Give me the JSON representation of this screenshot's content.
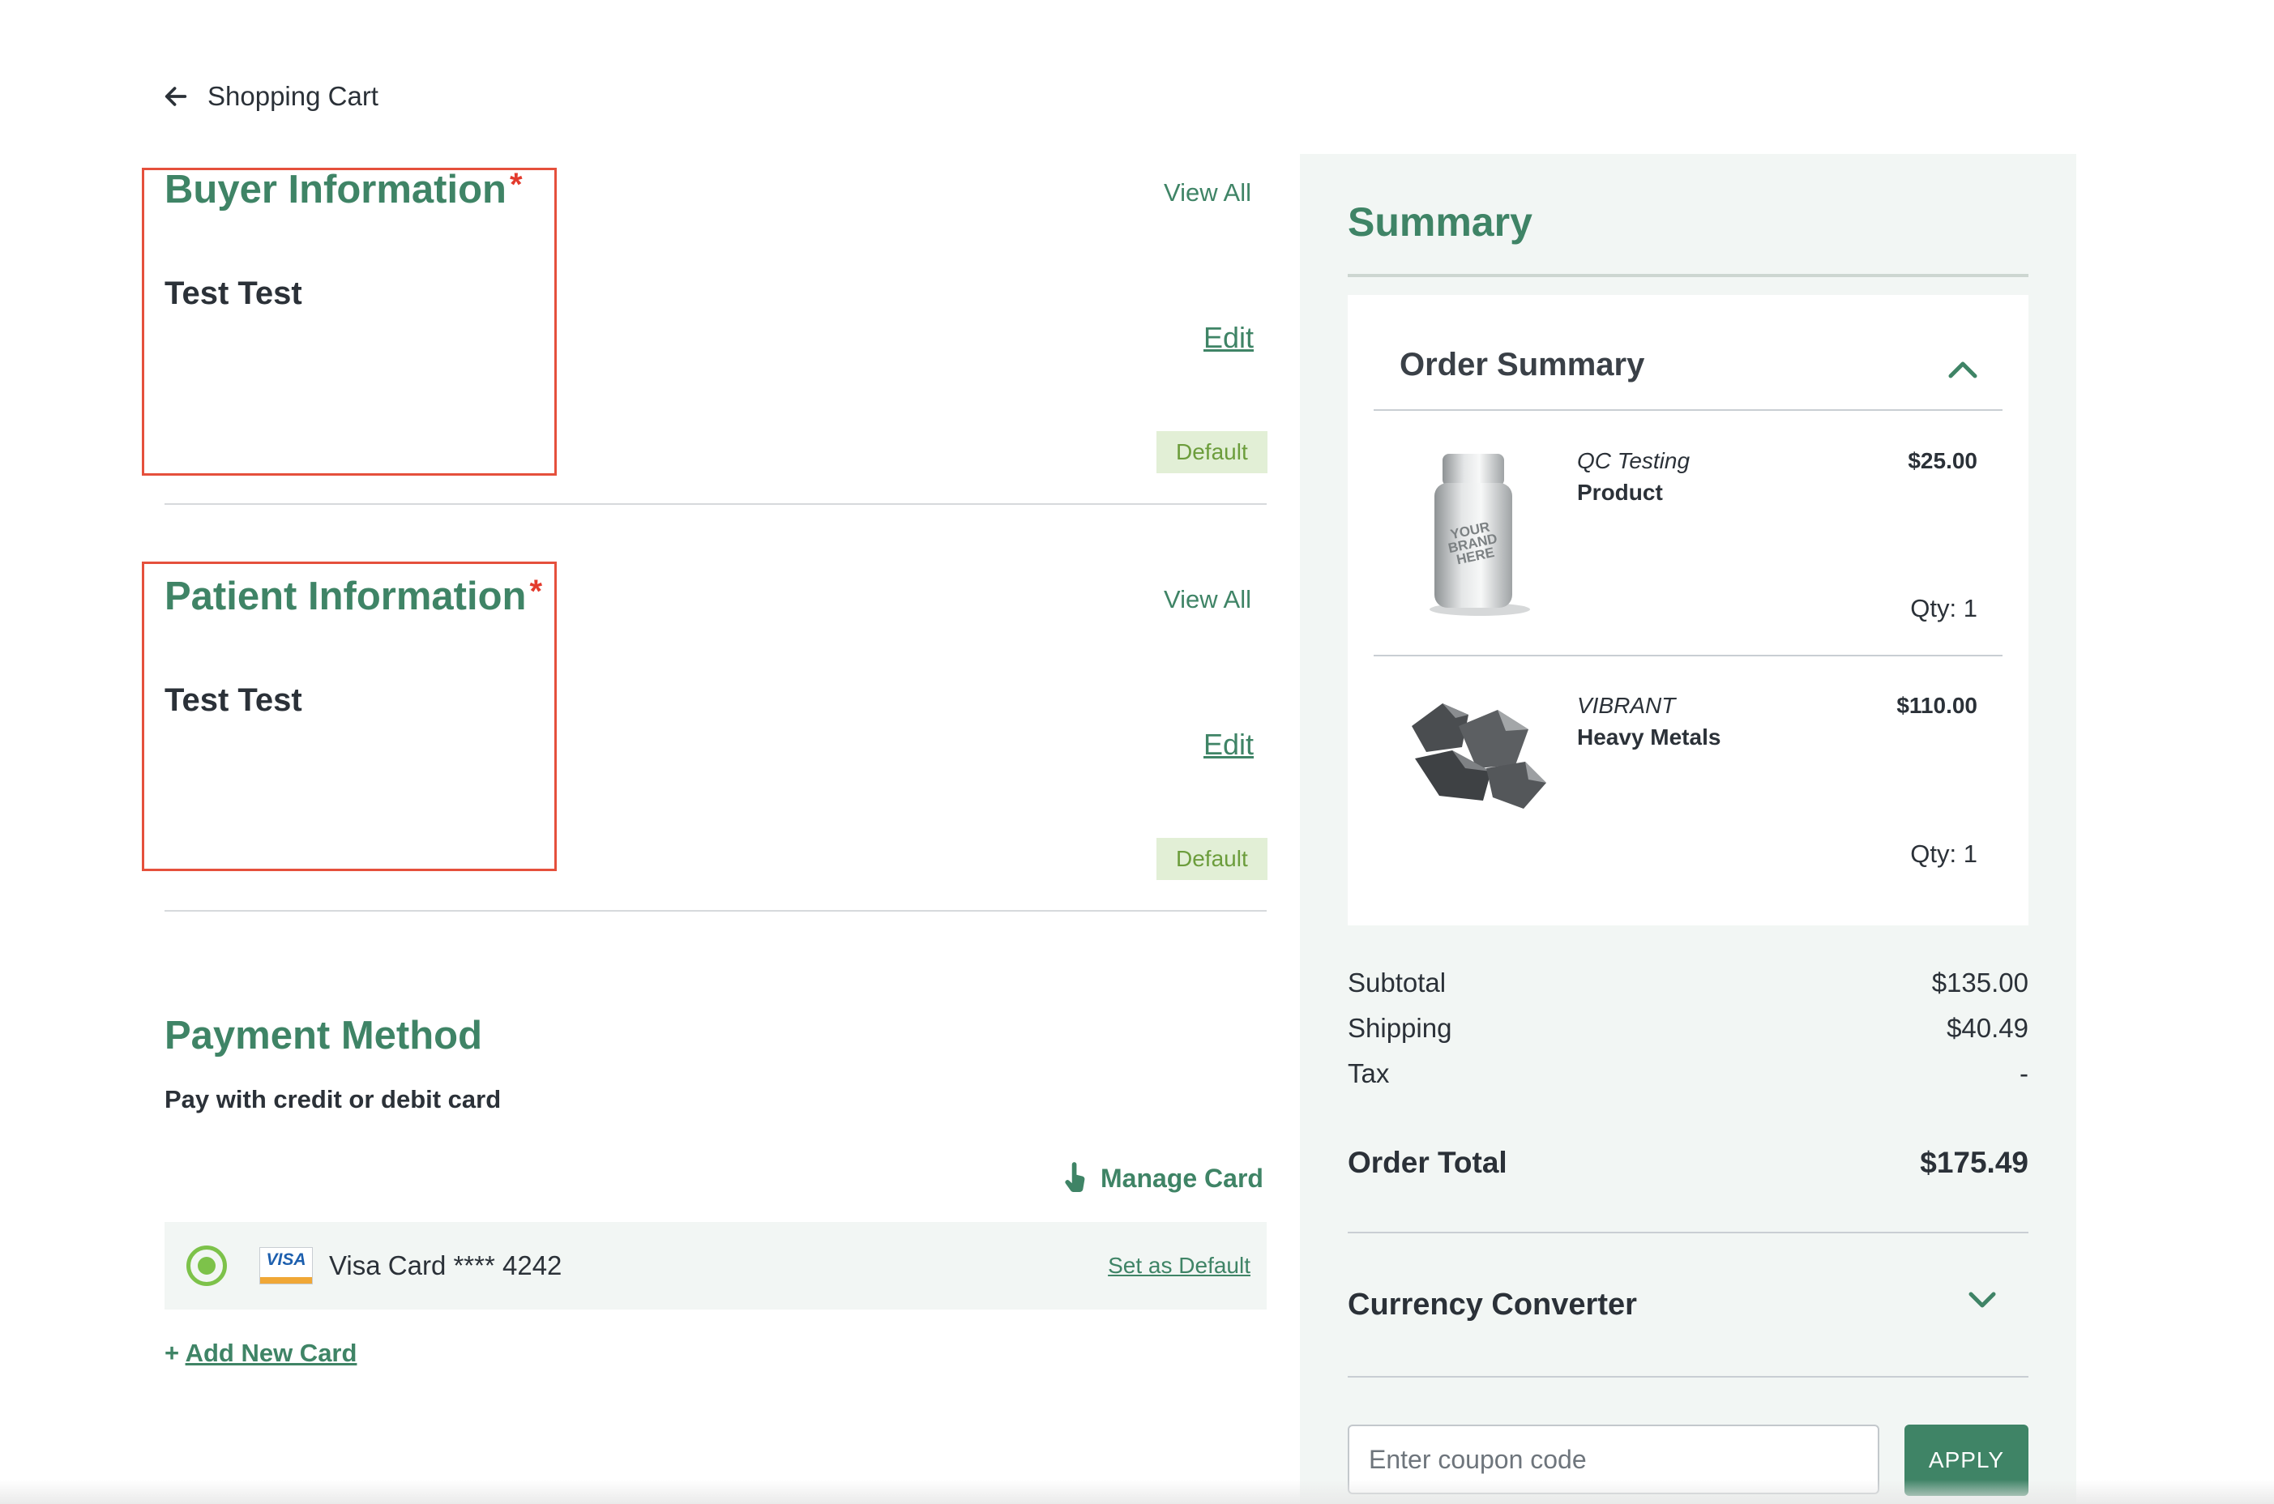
{
  "nav": {
    "back_label": "Shopping Cart"
  },
  "buyer": {
    "title": "Buyer Information",
    "required_mark": "*",
    "name": "Test Test",
    "view_all": "View All",
    "edit": "Edit",
    "badge": "Default"
  },
  "patient": {
    "title": "Patient Information",
    "required_mark": "*",
    "name": "Test Test",
    "view_all": "View All",
    "edit": "Edit",
    "badge": "Default"
  },
  "payment": {
    "title": "Payment Method",
    "subtitle": "Pay with credit or debit card",
    "manage_card": "Manage Card",
    "card": {
      "brand": "VISA",
      "label": "Visa Card **** 4242",
      "set_default": "Set as Default",
      "selected": true
    },
    "add_card_plus": "+",
    "add_card": "Add New Card"
  },
  "summary": {
    "title": "Summary",
    "order_summary": {
      "title": "Order Summary",
      "items": [
        {
          "category": "QC Testing",
          "name": "Product",
          "price": "$25.00",
          "qty": "Qty: 1",
          "image": "supplement-bottle",
          "image_text": "YOUR BRAND HERE"
        },
        {
          "category": "VIBRANT",
          "name": "Heavy Metals",
          "price": "$110.00",
          "qty": "Qty: 1",
          "image": "metal-rocks"
        }
      ]
    },
    "totals": {
      "subtotal_label": "Subtotal",
      "subtotal": "$135.00",
      "shipping_label": "Shipping",
      "shipping": "$40.49",
      "tax_label": "Tax",
      "tax": "-",
      "order_total_label": "Order Total",
      "order_total": "$175.49"
    },
    "currency_converter": "Currency Converter",
    "coupon": {
      "placeholder": "Enter coupon code",
      "apply": "APPLY"
    }
  },
  "colors": {
    "accent": "#3f8466",
    "required": "#e33b2d",
    "highlight_box": "#e5503c",
    "badge_bg": "#e2efd6",
    "radio": "#7dc24a",
    "panel_bg": "#f2f6f4"
  }
}
